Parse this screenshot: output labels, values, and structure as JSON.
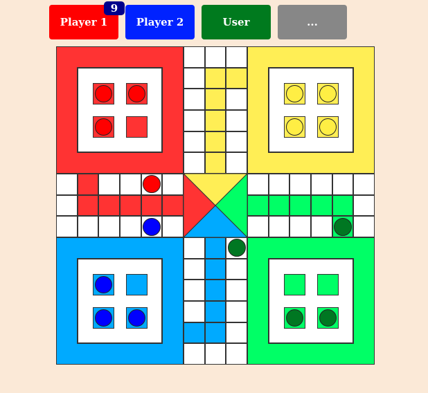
{
  "players": [
    {
      "id": "player1",
      "label": "Player 1",
      "color": "#ff0000",
      "badge": "9",
      "badge_color": "#00008b"
    },
    {
      "id": "player2",
      "label": "Player 2",
      "color": "#0022ff"
    },
    {
      "id": "user",
      "label": "User",
      "color": "#007a1e"
    },
    {
      "id": "more",
      "label": "...",
      "color": "#878787"
    }
  ],
  "colors": {
    "red": "#ff3333",
    "yellow": "#ffee55",
    "blue": "#00aaff",
    "green": "#00ff66",
    "red_token": "#ff0000",
    "yellow_token": "#ffee44",
    "blue_token": "#0000ff",
    "green_token": "#007722",
    "cell": "#ffffff",
    "background": "#fbe9d7"
  },
  "home_tokens": {
    "red": [
      true,
      true,
      true,
      false
    ],
    "yellow": [
      true,
      true,
      true,
      true
    ],
    "blue": [
      true,
      false,
      true,
      true
    ],
    "green": [
      false,
      false,
      true,
      true
    ]
  },
  "track_tokens": [
    {
      "color": "red",
      "cell": "row 6, column 5"
    },
    {
      "color": "blue",
      "cell": "row 8, column 5"
    },
    {
      "color": "green",
      "cell": "row 8, column 13"
    },
    {
      "color": "green",
      "cell": "row 9, column 9"
    }
  ]
}
